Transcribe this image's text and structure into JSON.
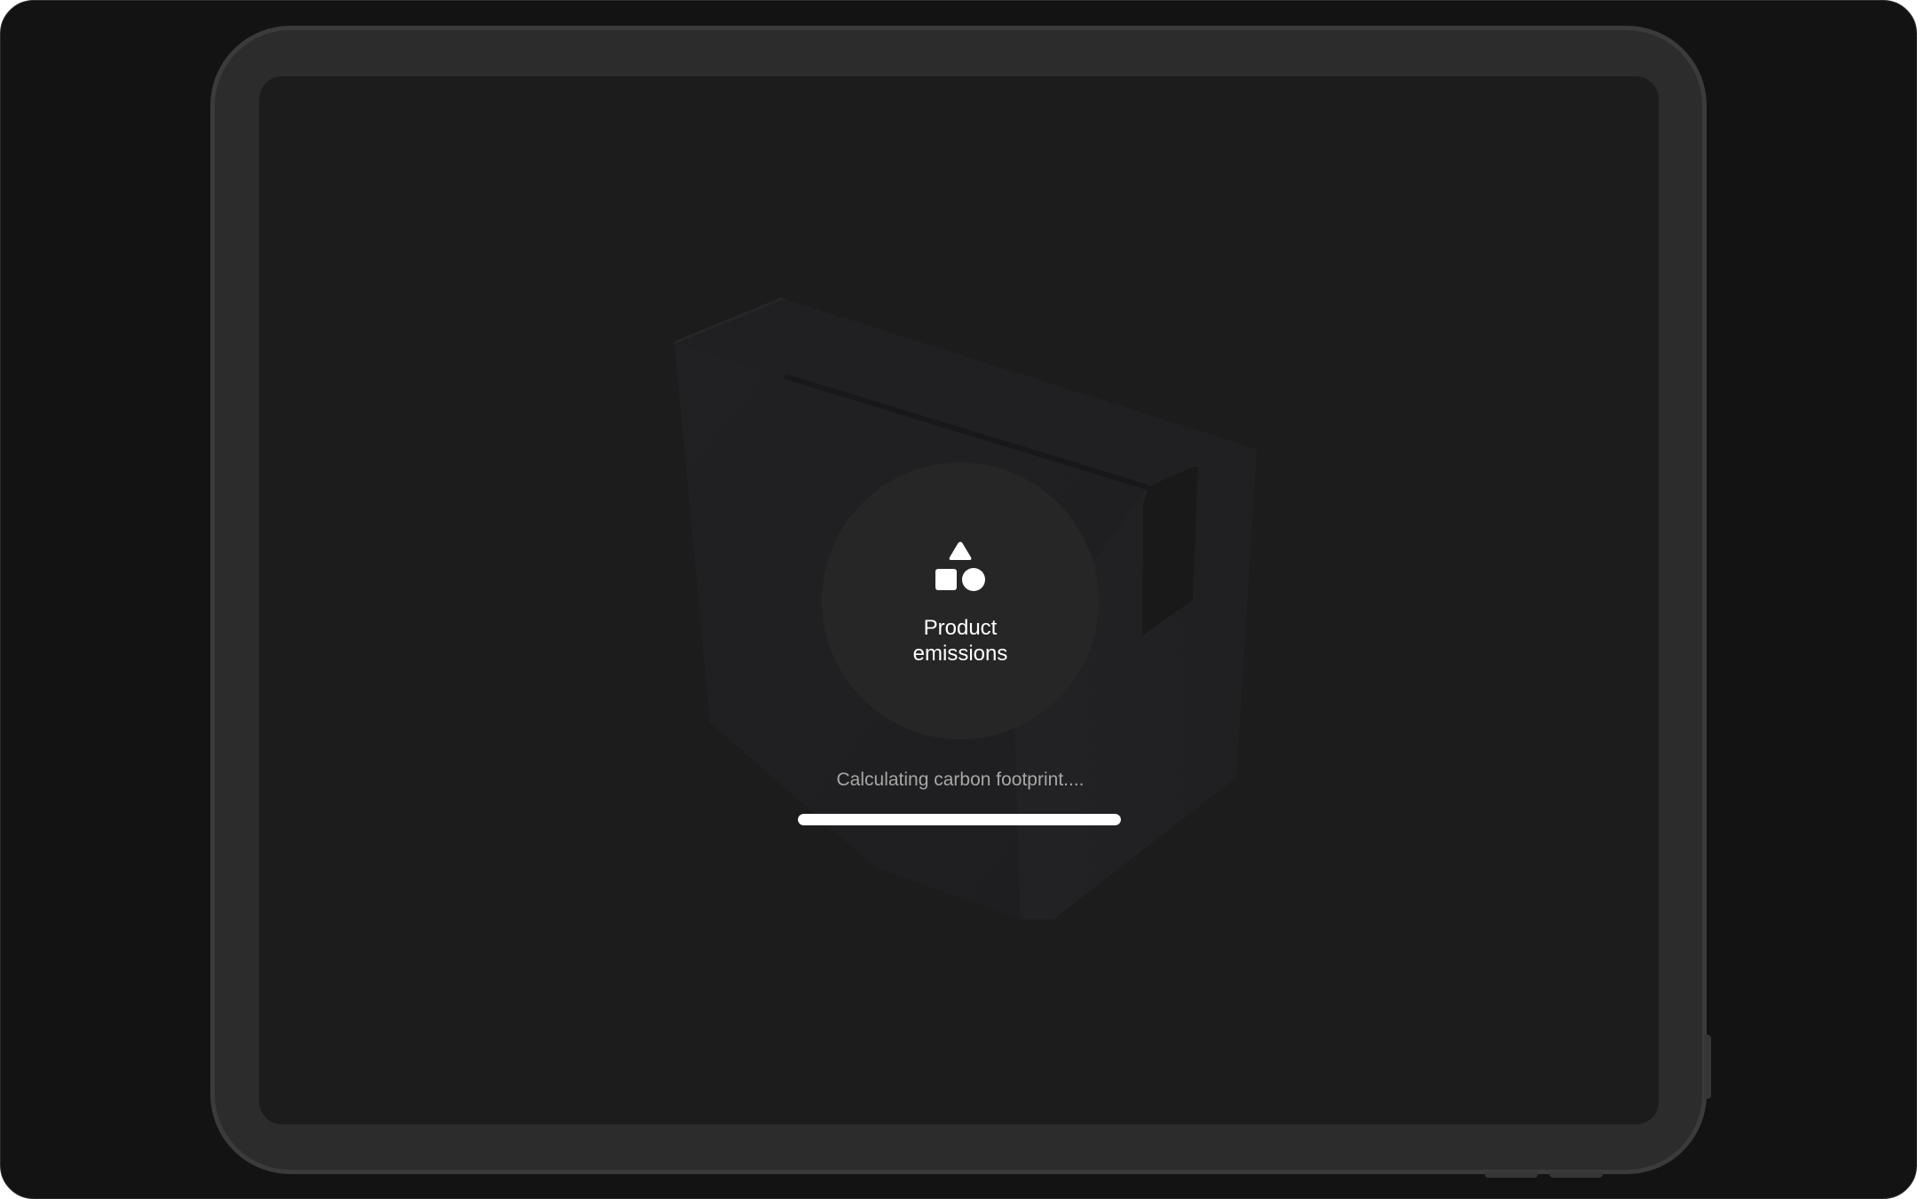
{
  "screen": {
    "emblem": {
      "icon": "shapes-icon",
      "title_line1": "Product",
      "title_line2": "emissions"
    },
    "status_text": "Calculating carbon footprint....",
    "progress": 1.0
  },
  "colors": {
    "background": "#131313",
    "frame": "#2c2c2c",
    "screen": "#1c1c1c",
    "emblem": "#262626",
    "accent": "#ffffff",
    "status_text": "#a7a7a7"
  }
}
